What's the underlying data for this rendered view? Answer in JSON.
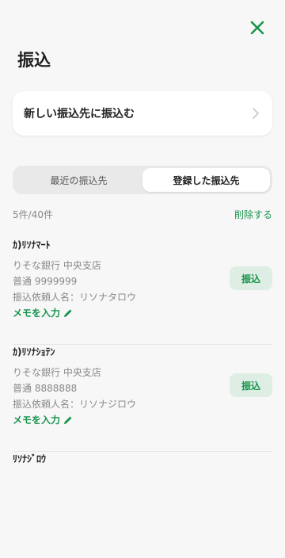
{
  "header": {
    "title": "振込",
    "close_icon": "close-icon"
  },
  "new_payee": {
    "label": "新しい振込先に振込む",
    "chevron_icon": "chevron-right-icon"
  },
  "tabs": [
    {
      "label": "最近の振込先",
      "active": false
    },
    {
      "label": "登録した振込先",
      "active": true
    }
  ],
  "list_header": {
    "count": "5件/40件",
    "delete_label": "削除する"
  },
  "payees": [
    {
      "name": "ｶ)ﾘｿﾅﾏｰﾄ",
      "bank": "りそな銀行 中央支店",
      "account": "普通 9999999",
      "requester": "振込依頼人名：リソナタロウ",
      "memo_label": "メモを入力",
      "transfer_label": "振込"
    },
    {
      "name": "ｶ)ﾘｿﾅｼｮﾃﾝ",
      "bank": "りそな銀行 中央支店",
      "account": "普通 8888888",
      "requester": "振込依頼人名：リソナジロウ",
      "memo_label": "メモを入力",
      "transfer_label": "振込"
    },
    {
      "name": "ﾘｿﾅｼﾞﾛｳ",
      "bank": "",
      "account": "",
      "requester": "",
      "memo_label": "",
      "transfer_label": ""
    }
  ],
  "colors": {
    "accent": "#18944d",
    "button_bg": "#dfeee4",
    "background": "#f7f7f7"
  }
}
